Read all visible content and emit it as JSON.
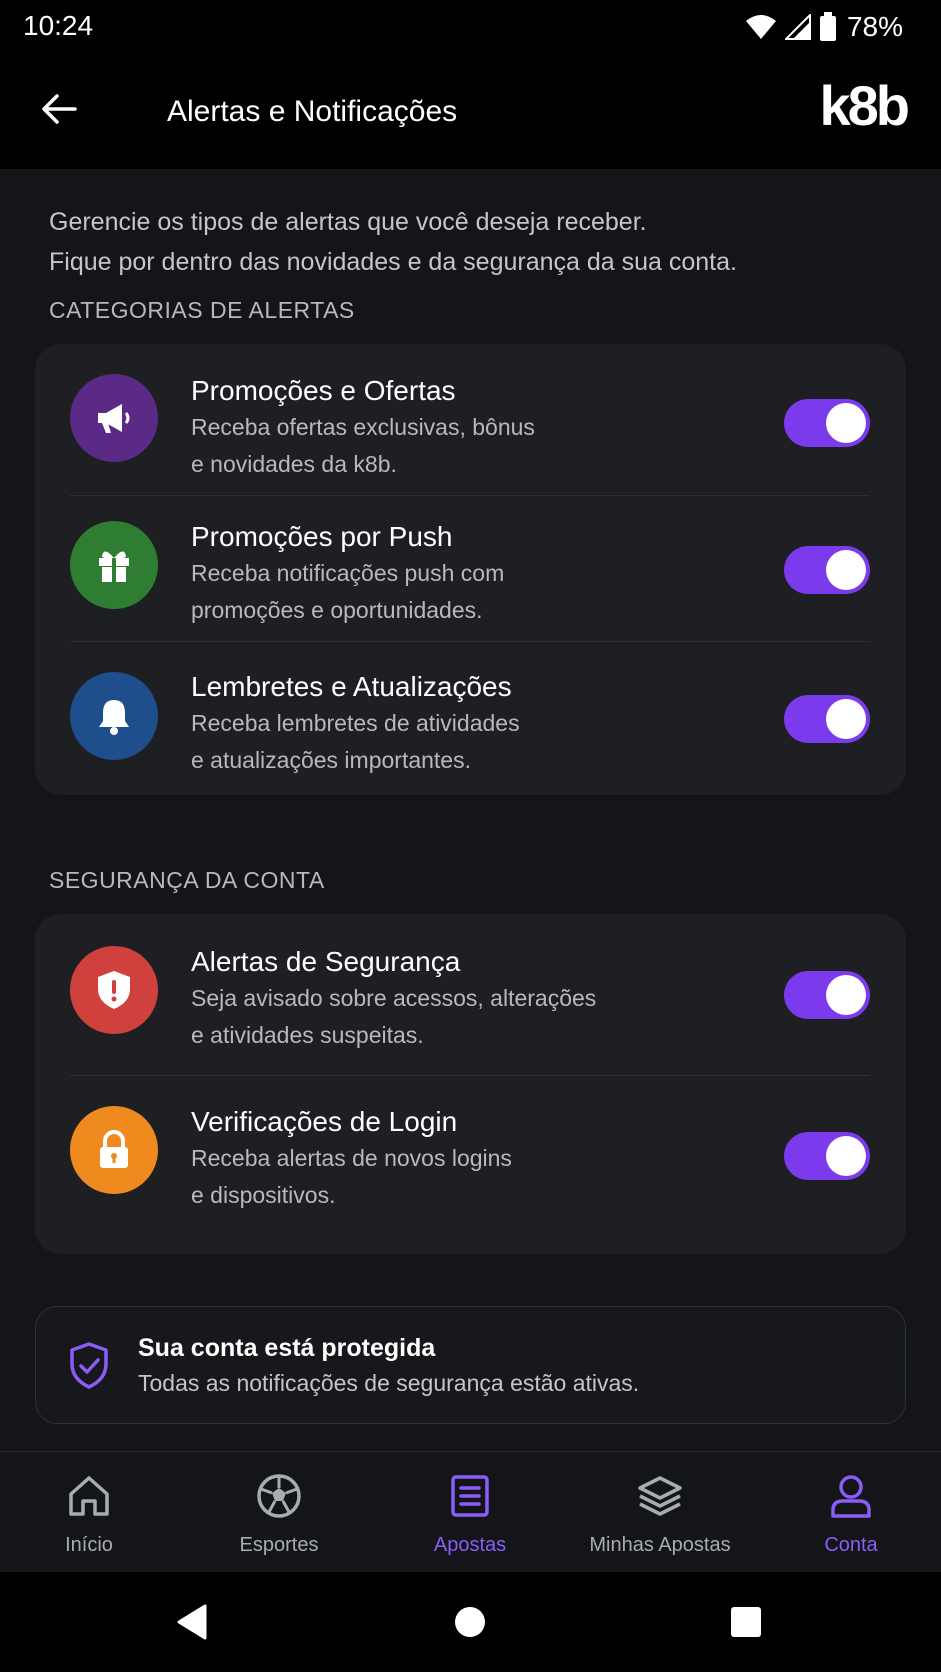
{
  "status_bar": {
    "time": "10:24",
    "battery": "78%"
  },
  "header": {
    "title": "Alertas e Notificações",
    "logo": "k8b"
  },
  "intro": {
    "line1": "Gerencie os tipos de alertas que você deseja receber.",
    "line2": "Fique por dentro das novidades e da segurança da sua conta."
  },
  "sections": [
    {
      "title": "CATEGORIAS DE ALERTAS",
      "items": [
        {
          "title": "Promoções e Ofertas",
          "desc1": "Receba ofertas exclusivas, bônus",
          "desc2": "e novidades da k8b.",
          "icon": "megaphone-icon",
          "icon_color": "#5b2a86",
          "enabled": true
        },
        {
          "title": "Promoções por Push",
          "desc1": "Receba notificações push com",
          "desc2": "promoções e oportunidades.",
          "icon": "gift-icon",
          "icon_color": "#2e7d32",
          "enabled": true
        },
        {
          "title": "Lembretes e Atualizações",
          "desc1": "Receba lembretes de atividades",
          "desc2": "e atualizações importantes.",
          "icon": "bell-icon",
          "icon_color": "#1f4e8c",
          "enabled": true
        }
      ]
    },
    {
      "title": "SEGURANÇA DA CONTA",
      "items": [
        {
          "title": "Alertas de Segurança",
          "desc1": "Seja avisado sobre acessos, alterações",
          "desc2": "e atividades suspeitas.",
          "icon": "shield-alert-icon",
          "icon_color": "#d0413e",
          "enabled": true
        },
        {
          "title": "Verificações de Login",
          "desc1": "Receba alertas de novos logins",
          "desc2": "e dispositivos.",
          "icon": "lock-icon",
          "icon_color": "#ef8a1f",
          "enabled": true
        }
      ]
    }
  ],
  "protection": {
    "title": "Sua conta está protegida",
    "desc": "Todas as notificações de segurança estão ativas."
  },
  "bottom_nav": [
    {
      "label": "Início",
      "icon": "home-icon",
      "active": false
    },
    {
      "label": "Esportes",
      "icon": "soccer-ball-icon",
      "active": false
    },
    {
      "label": "Apostas",
      "icon": "bet-slip-icon",
      "active": true
    },
    {
      "label": "Minhas Apostas",
      "icon": "layers-icon",
      "active": false
    },
    {
      "label": "Conta",
      "icon": "user-icon",
      "active": true
    }
  ],
  "colors": {
    "accent": "#8b5cf6",
    "toggle_on": "#7c3aed",
    "background": "#141518",
    "card": "#1d1f23"
  }
}
